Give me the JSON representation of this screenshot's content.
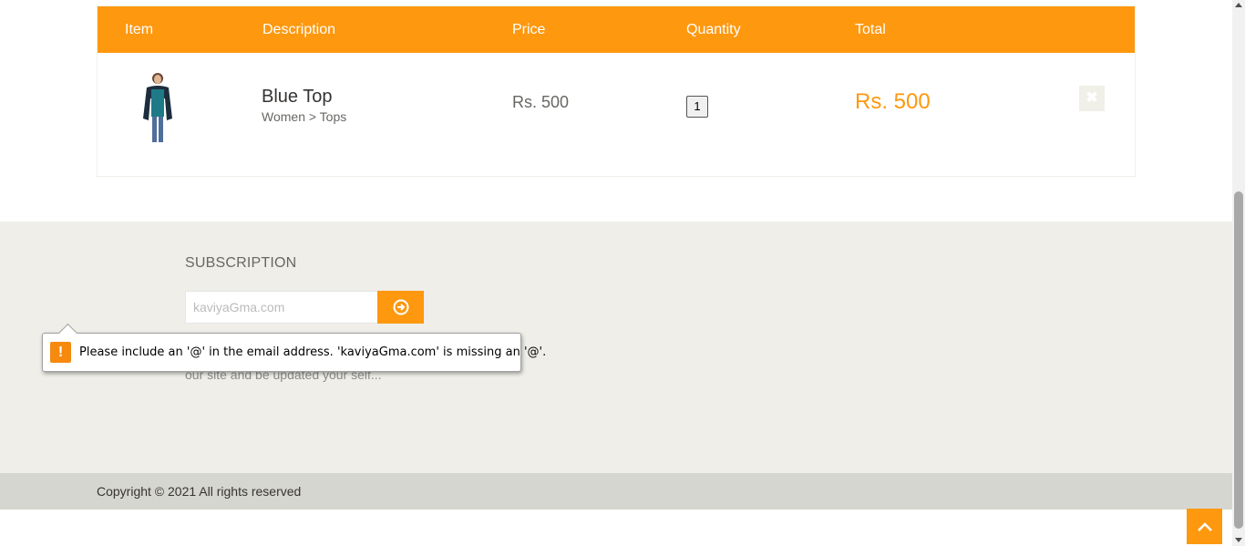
{
  "cart": {
    "headers": {
      "item": "Item",
      "description": "Description",
      "price": "Price",
      "quantity": "Quantity",
      "total": "Total"
    },
    "rows": [
      {
        "name": "Blue Top",
        "category": "Women > Tops",
        "price": "Rs. 500",
        "quantity": "1",
        "total": "Rs. 500",
        "delete_icon": "close-icon"
      }
    ]
  },
  "subscription": {
    "title": "SUBSCRIPTION",
    "email_value": "kaviyaGma.com",
    "button_icon": "arrow-circle-right-icon",
    "description_visible": "our site and be updated your self..."
  },
  "validation": {
    "icon": "exclamation-icon",
    "message": "Please include an '@' in the email address. 'kaviyaGma.com' is missing an '@'."
  },
  "footer": {
    "copyright": "Copyright © 2021 All rights reserved"
  },
  "colors": {
    "accent": "#fe980f",
    "footer_bg": "#efeee8",
    "footer_bottom_bg": "#d6d6d0"
  }
}
